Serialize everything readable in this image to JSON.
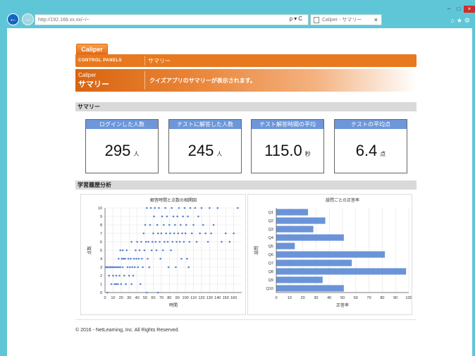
{
  "browser": {
    "address": "http://192.168.xx.xx/~/~",
    "tab_title": "Caliper - サマリー",
    "back_label": "←",
    "forward_label": "→",
    "address_controls": "ρ▾C",
    "tab_close": "×",
    "win_minimize": "–",
    "win_maximize": "□",
    "win_close": "×",
    "toolbar_icons": "⌂★⚙"
  },
  "app": {
    "tab_label": "Caliper",
    "control_panels_label": "CONTROL PANELS",
    "breadcrumb": "サマリー",
    "header_sub": "Caliper",
    "header_title": "サマリー",
    "header_desc": "クイズアプリのサマリーが表示されます。"
  },
  "summary": {
    "section_title": "サマリー",
    "stats": [
      {
        "label": "ログインした人数",
        "value": "295",
        "unit": "人"
      },
      {
        "label": "テストに解答した人数",
        "value": "245",
        "unit": "人"
      },
      {
        "label": "テスト解答時間の平均",
        "value": "115.0",
        "unit": "秒"
      },
      {
        "label": "テストの平均点",
        "value": "6.4",
        "unit": "点"
      }
    ]
  },
  "analysis": {
    "section_title": "学習履歴分析"
  },
  "footer": "© 2016 - NetLearning, Inc. All Rights Reserved.",
  "colors": {
    "orange": "#e8791e",
    "stat_header": "#6d97d9",
    "bar": "#6b94d8",
    "point": "#5b84cf"
  },
  "chart_data": [
    {
      "type": "scatter",
      "title": "解答時間と点数の相関図",
      "xlabel": "時間",
      "ylabel": "点数",
      "xlim": [
        0,
        170
      ],
      "ylim": [
        0,
        10
      ],
      "xticks": [
        0,
        10,
        20,
        30,
        40,
        50,
        60,
        70,
        80,
        90,
        100,
        110,
        120,
        130,
        140,
        150,
        160
      ],
      "yticks": [
        0,
        1,
        2,
        3,
        4,
        5,
        6,
        7,
        8,
        9,
        10
      ],
      "points": [
        [
          1,
          3
        ],
        [
          2,
          3
        ],
        [
          3,
          3
        ],
        [
          4,
          3
        ],
        [
          5,
          2
        ],
        [
          6,
          3
        ],
        [
          7,
          3
        ],
        [
          8,
          1
        ],
        [
          9,
          3
        ],
        [
          10,
          2
        ],
        [
          11,
          3
        ],
        [
          12,
          1
        ],
        [
          13,
          3
        ],
        [
          14,
          2
        ],
        [
          15,
          3
        ],
        [
          16,
          1
        ],
        [
          17,
          3
        ],
        [
          18,
          2
        ],
        [
          19,
          3
        ],
        [
          20,
          1
        ],
        [
          22,
          3
        ],
        [
          24,
          2
        ],
        [
          25,
          4
        ],
        [
          26,
          1
        ],
        [
          28,
          3
        ],
        [
          29,
          4
        ],
        [
          30,
          2
        ],
        [
          31,
          3
        ],
        [
          32,
          4
        ],
        [
          33,
          1
        ],
        [
          34,
          3
        ],
        [
          35,
          2
        ],
        [
          36,
          4
        ],
        [
          37,
          3
        ],
        [
          38,
          5
        ],
        [
          39,
          4
        ],
        [
          40,
          6
        ],
        [
          41,
          3
        ],
        [
          42,
          4
        ],
        [
          43,
          5
        ],
        [
          44,
          1
        ],
        [
          45,
          6
        ],
        [
          46,
          4
        ],
        [
          47,
          3
        ],
        [
          48,
          7
        ],
        [
          49,
          5
        ],
        [
          50,
          8
        ],
        [
          51,
          6
        ],
        [
          52,
          10
        ],
        [
          53,
          4
        ],
        [
          54,
          6
        ],
        [
          55,
          3
        ],
        [
          56,
          8
        ],
        [
          57,
          10
        ],
        [
          58,
          5
        ],
        [
          59,
          6
        ],
        [
          60,
          7
        ],
        [
          61,
          9
        ],
        [
          62,
          10
        ],
        [
          63,
          6
        ],
        [
          64,
          5
        ],
        [
          65,
          8
        ],
        [
          66,
          7
        ],
        [
          67,
          10
        ],
        [
          68,
          6
        ],
        [
          69,
          4
        ],
        [
          70,
          7
        ],
        [
          71,
          9
        ],
        [
          72,
          5
        ],
        [
          73,
          8
        ],
        [
          74,
          6
        ],
        [
          75,
          10
        ],
        [
          76,
          7
        ],
        [
          77,
          9
        ],
        [
          78,
          6
        ],
        [
          79,
          3
        ],
        [
          80,
          8
        ],
        [
          81,
          7
        ],
        [
          82,
          5
        ],
        [
          83,
          10
        ],
        [
          84,
          6
        ],
        [
          85,
          9
        ],
        [
          86,
          7
        ],
        [
          87,
          8
        ],
        [
          88,
          3
        ],
        [
          89,
          6
        ],
        [
          90,
          9
        ],
        [
          91,
          7
        ],
        [
          92,
          10
        ],
        [
          93,
          6
        ],
        [
          94,
          8
        ],
        [
          95,
          4
        ],
        [
          96,
          7
        ],
        [
          97,
          9
        ],
        [
          98,
          6
        ],
        [
          99,
          10
        ],
        [
          100,
          7
        ],
        [
          101,
          8
        ],
        [
          102,
          4
        ],
        [
          103,
          9
        ],
        [
          104,
          3
        ],
        [
          105,
          6
        ],
        [
          106,
          10
        ],
        [
          108,
          7
        ],
        [
          110,
          8
        ],
        [
          112,
          10
        ],
        [
          114,
          6
        ],
        [
          116,
          9
        ],
        [
          118,
          7
        ],
        [
          120,
          10
        ],
        [
          122,
          8
        ],
        [
          125,
          7
        ],
        [
          128,
          6
        ],
        [
          130,
          10
        ],
        [
          132,
          7
        ],
        [
          135,
          8
        ],
        [
          140,
          10
        ],
        [
          145,
          6
        ],
        [
          150,
          7
        ],
        [
          155,
          6
        ],
        [
          160,
          7
        ],
        [
          165,
          10
        ],
        [
          22,
          5
        ],
        [
          23,
          4
        ],
        [
          27,
          5
        ],
        [
          33,
          6
        ],
        [
          3,
          0
        ],
        [
          14,
          1
        ],
        [
          52,
          0
        ],
        [
          66,
          0
        ],
        [
          17,
          4
        ],
        [
          21,
          4
        ],
        [
          19,
          5
        ]
      ]
    },
    {
      "type": "bar",
      "orientation": "horizontal",
      "title": "設問ごとの正答率",
      "xlabel": "正答率",
      "ylabel": "設問",
      "xlim": [
        0,
        100
      ],
      "xticks": [
        0,
        10,
        20,
        30,
        40,
        50,
        60,
        70,
        80,
        90,
        100
      ],
      "categories": [
        "Q1",
        "Q2",
        "Q3",
        "Q4",
        "Q5",
        "Q6",
        "Q7",
        "Q8",
        "Q9",
        "Q10"
      ],
      "values": [
        24,
        37,
        28,
        51,
        14,
        82,
        57,
        98,
        35,
        51
      ]
    }
  ]
}
